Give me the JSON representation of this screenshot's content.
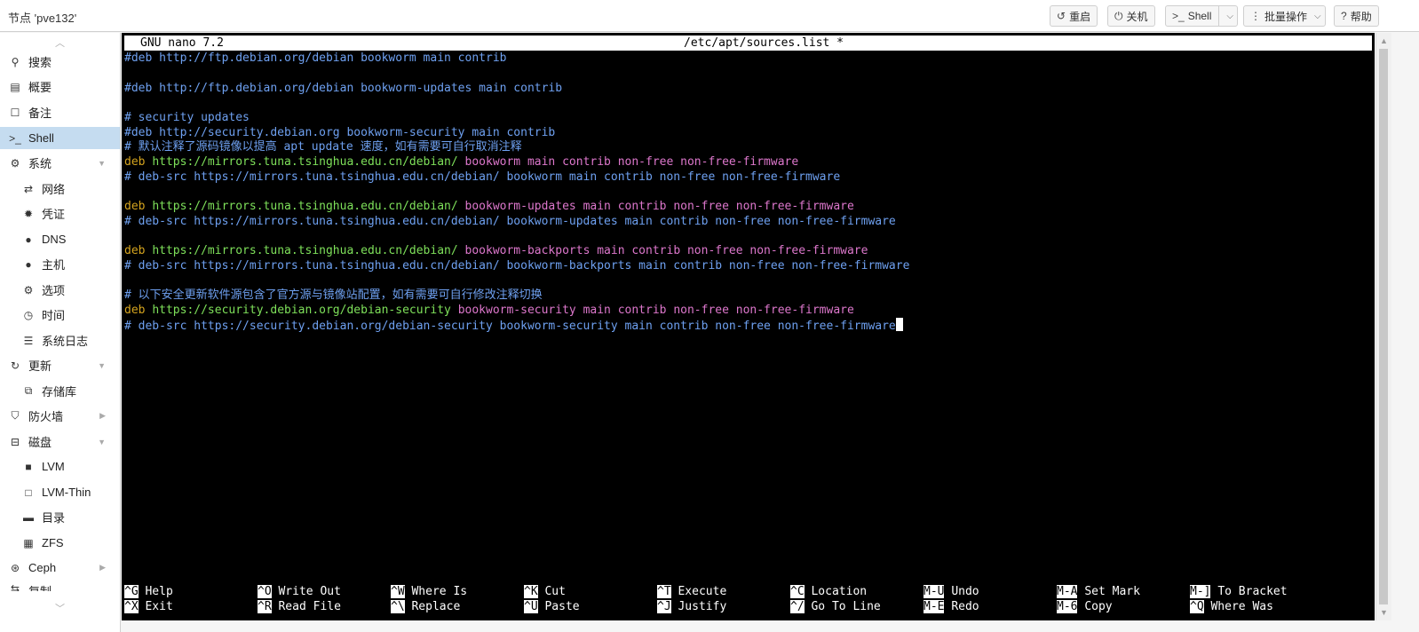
{
  "header": {
    "node_title": "节点 'pve132'",
    "buttons": {
      "reboot": "重启",
      "shutdown": "关机",
      "shell": "Shell",
      "bulk": "批量操作",
      "help": "帮助"
    }
  },
  "sidebar": {
    "items": [
      {
        "label": "搜索",
        "icon": "search-icon"
      },
      {
        "label": "概要",
        "icon": "book-icon"
      },
      {
        "label": "备注",
        "icon": "note-icon"
      },
      {
        "label": "Shell",
        "icon": "terminal-icon"
      },
      {
        "label": "系统",
        "icon": "gears-icon"
      },
      {
        "label": "网络",
        "icon": "exchange-icon"
      },
      {
        "label": "凭证",
        "icon": "certificate-icon"
      },
      {
        "label": "DNS",
        "icon": "globe-icon"
      },
      {
        "label": "主机",
        "icon": "globe-icon"
      },
      {
        "label": "选项",
        "icon": "gear-icon"
      },
      {
        "label": "时间",
        "icon": "clock-icon"
      },
      {
        "label": "系统日志",
        "icon": "list-icon"
      },
      {
        "label": "更新",
        "icon": "refresh-icon"
      },
      {
        "label": "存储库",
        "icon": "files-icon"
      },
      {
        "label": "防火墙",
        "icon": "shield-icon"
      },
      {
        "label": "磁盘",
        "icon": "hdd-icon"
      },
      {
        "label": "LVM",
        "icon": "square-icon"
      },
      {
        "label": "LVM-Thin",
        "icon": "square-outline-icon"
      },
      {
        "label": "目录",
        "icon": "folder-icon"
      },
      {
        "label": "ZFS",
        "icon": "grid-icon"
      },
      {
        "label": "Ceph",
        "icon": "ceph-icon"
      },
      {
        "label": "复制",
        "icon": "retweet-icon"
      }
    ]
  },
  "terminal": {
    "version": "GNU nano 7.2",
    "filename": "/etc/apt/sources.list *",
    "lines": [
      {
        "c": "#deb http://ftp.debian.org/debian bookworm main contrib"
      },
      {
        "c": "#deb http://ftp.debian.org/debian bookworm-updates main contrib"
      },
      {
        "c": "# security updates"
      },
      {
        "c": "#deb http://security.debian.org bookworm-security main contrib"
      },
      {
        "c": "# 默认注释了源码镜像以提高 apt update 速度，如有需要可自行取消注释"
      },
      {
        "k": "deb",
        "u": "https://mirrors.tuna.tsinghua.edu.cn/debian/",
        "r": "bookworm main contrib non-free non-free-firmware"
      },
      {
        "c": "# deb-src https://mirrors.tuna.tsinghua.edu.cn/debian/ bookworm main contrib non-free non-free-firmware"
      },
      {
        "k": "deb",
        "u": "https://mirrors.tuna.tsinghua.edu.cn/debian/",
        "r": "bookworm-updates main contrib non-free non-free-firmware"
      },
      {
        "c": "# deb-src https://mirrors.tuna.tsinghua.edu.cn/debian/ bookworm-updates main contrib non-free non-free-firmware"
      },
      {
        "k": "deb",
        "u": "https://mirrors.tuna.tsinghua.edu.cn/debian/",
        "r": "bookworm-backports main contrib non-free non-free-firmware"
      },
      {
        "c": "# deb-src https://mirrors.tuna.tsinghua.edu.cn/debian/ bookworm-backports main contrib non-free non-free-firmware"
      },
      {
        "c": "# 以下安全更新软件源包含了官方源与镜像站配置，如有需要可自行修改注释切换"
      },
      {
        "k": "deb",
        "u": "https://security.debian.org/debian-security",
        "r": "bookworm-security main contrib non-free non-free-firmware"
      },
      {
        "c": "# deb-src https://security.debian.org/debian-security bookworm-security main contrib non-free non-free-firmware"
      }
    ],
    "shortcuts": [
      {
        "key": "^G",
        "label": "Help"
      },
      {
        "key": "^X",
        "label": "Exit"
      },
      {
        "key": "^O",
        "label": "Write Out"
      },
      {
        "key": "^R",
        "label": "Read File"
      },
      {
        "key": "^W",
        "label": "Where Is"
      },
      {
        "key": "^\\",
        "label": "Replace"
      },
      {
        "key": "^K",
        "label": "Cut"
      },
      {
        "key": "^U",
        "label": "Paste"
      },
      {
        "key": "^T",
        "label": "Execute"
      },
      {
        "key": "^J",
        "label": "Justify"
      },
      {
        "key": "^C",
        "label": "Location"
      },
      {
        "key": "^/",
        "label": "Go To Line"
      },
      {
        "key": "M-U",
        "label": "Undo"
      },
      {
        "key": "M-E",
        "label": "Redo"
      },
      {
        "key": "M-A",
        "label": "Set Mark"
      },
      {
        "key": "M-6",
        "label": "Copy"
      },
      {
        "key": "M-]",
        "label": "To Bracket"
      },
      {
        "key": "^Q",
        "label": "Where Was"
      }
    ]
  },
  "colors": {
    "comment": "#6ea0f0",
    "keyword": "#d5a41e",
    "url": "#7ee05a",
    "rest": "#dd77cc",
    "active_nav": "#c5dcf0"
  }
}
